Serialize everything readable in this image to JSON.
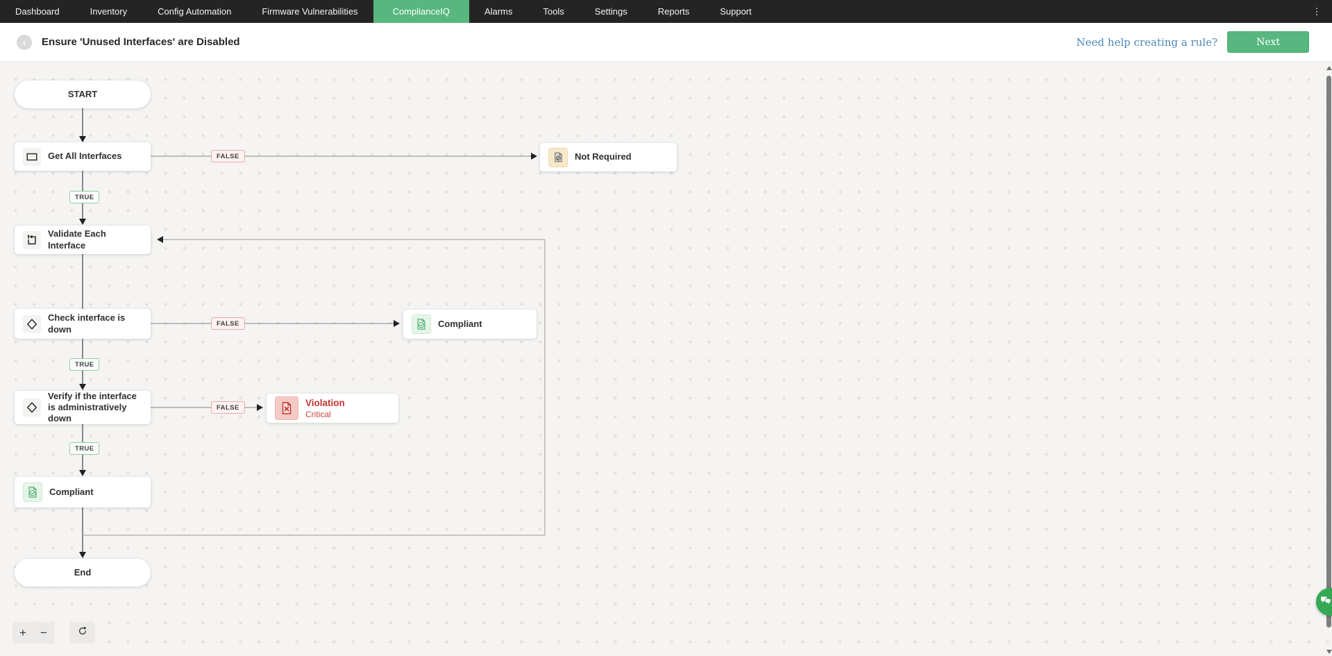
{
  "navbar": {
    "items": [
      {
        "label": "Dashboard"
      },
      {
        "label": "Inventory"
      },
      {
        "label": "Config Automation"
      },
      {
        "label": "Firmware Vulnerabilities"
      },
      {
        "label": "ComplianceIQ",
        "active": true
      },
      {
        "label": "Alarms"
      },
      {
        "label": "Tools"
      },
      {
        "label": "Settings"
      },
      {
        "label": "Reports"
      },
      {
        "label": "Support"
      }
    ],
    "more_icon": "kebab-menu"
  },
  "header": {
    "title": "Ensure 'Unused Interfaces' are Disabled",
    "help_link": "Need help creating a rule?",
    "next_button": "Next"
  },
  "colors": {
    "nav_background": "#242424",
    "accent_green": "#57b77e",
    "link_blue": "#4a89b8",
    "violation_red": "#c2342e",
    "canvas_background": "#f5f4f2"
  },
  "flowchart": {
    "labels": {
      "true": "TRUE",
      "false": "FALSE"
    },
    "nodes": {
      "start": {
        "label": "START"
      },
      "get_all_interfaces": {
        "label": "Get All Interfaces",
        "icon": "rectangle-icon"
      },
      "not_required": {
        "label": "Not Required",
        "icon": "document-slash-icon"
      },
      "validate_each_interface": {
        "label": "Validate Each Interface",
        "icon": "loop-icon"
      },
      "check_interface_down": {
        "label": "Check interface is down",
        "icon": "diamond-icon"
      },
      "compliant_right": {
        "label": "Compliant",
        "icon": "document-check-icon"
      },
      "verify_admin_down": {
        "label": "Verify if the interface is administratively down",
        "icon": "diamond-icon"
      },
      "violation": {
        "label": "Violation",
        "severity": "Critical",
        "icon": "document-x-icon"
      },
      "compliant_bottom": {
        "label": "Compliant",
        "icon": "document-check-icon"
      },
      "end": {
        "label": "End"
      }
    }
  },
  "canvas_controls": {
    "zoom_in": "+",
    "zoom_out": "−",
    "reset_icon": "refresh-icon"
  }
}
